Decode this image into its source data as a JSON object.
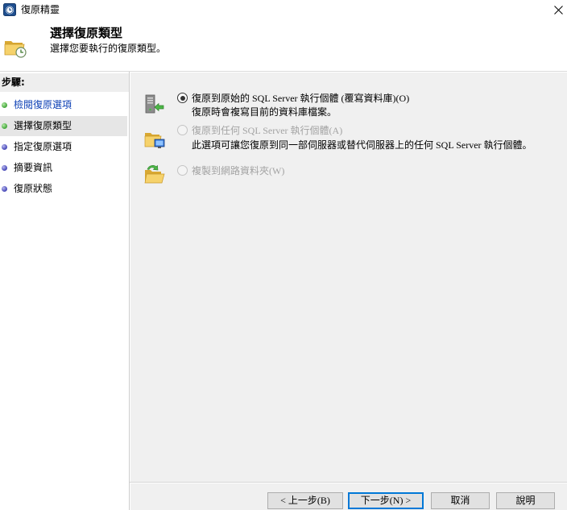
{
  "window": {
    "title": "復原精靈",
    "app_icon": "restore-wizard-icon",
    "close_icon": "close-icon"
  },
  "header": {
    "title": "選擇復原類型",
    "subtitle": "選擇您要執行的復原類型。",
    "icon": "folder-clock-icon"
  },
  "steps": {
    "heading": "步驟:",
    "items": [
      {
        "label": "檢閱復原選項",
        "done": true,
        "current": false
      },
      {
        "label": "選擇復原類型",
        "done": false,
        "current": true
      },
      {
        "label": "指定復原選項",
        "done": false,
        "current": false
      },
      {
        "label": "摘要資訊",
        "done": false,
        "current": false
      },
      {
        "label": "復原狀態",
        "done": false,
        "current": false
      }
    ]
  },
  "options": [
    {
      "label": "復原到原始的 SQL Server 執行個體 (覆寫資料庫)(O)",
      "description": "復原時會複寫目前的資料庫檔案。",
      "selected": true,
      "enabled": true,
      "icon": "server-restore-icon"
    },
    {
      "label": "復原到任何 SQL Server 執行個體(A)",
      "description": "此選項可讓您復原到同一部伺服器或替代伺服器上的任何 SQL Server 執行個體。",
      "selected": false,
      "enabled": false,
      "icon": "folder-computer-icon"
    },
    {
      "label": "複製到網路資料夾(W)",
      "selected": false,
      "enabled": false,
      "icon": "folder-copy-icon"
    }
  ],
  "buttons": {
    "back": "< 上一步(B)",
    "next": "下一步(N) >",
    "cancel": "取消",
    "help": "說明"
  },
  "colors": {
    "link": "#0b3fb5",
    "step_done_dot": "#46a83e",
    "step_pending_dot": "#4a4bb8",
    "current_step_bg": "#e6e6e6",
    "steps_header_bg": "#eeeeee",
    "panel_bg": "#f0f0f0",
    "focus_border": "#0078d7",
    "disabled_text": "#a3a3a3",
    "button_bg": "#e1e1e1",
    "button_border": "#adadad"
  }
}
